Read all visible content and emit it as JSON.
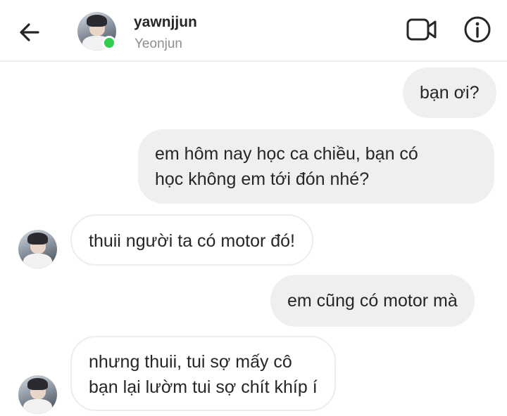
{
  "header": {
    "back_icon": "arrow-left-icon",
    "username": "yawnjjun",
    "display_name": "Yeonjun",
    "online_color": "#2fcc4e",
    "video_icon": "video-camera-icon",
    "info_icon": "info-icon"
  },
  "messages": [
    {
      "direction": "outgoing",
      "lines": [
        "bạn ơi?"
      ]
    },
    {
      "direction": "outgoing",
      "lines": [
        "em hôm nay học ca chiều, bạn có",
        "học không em tới đón nhé?"
      ]
    },
    {
      "direction": "incoming",
      "lines": [
        "thuii người ta có motor đó!"
      ]
    },
    {
      "direction": "outgoing",
      "lines": [
        "em cũng có motor mà"
      ]
    },
    {
      "direction": "incoming",
      "lines": [
        "nhưng thuii, tui sợ mấy cô",
        "bạn lại lườm tui sợ chít khíp í"
      ]
    }
  ],
  "colors": {
    "outgoing_bubble": "#efefef",
    "incoming_border": "#ededed",
    "secondary_text": "#8e8e8e"
  }
}
